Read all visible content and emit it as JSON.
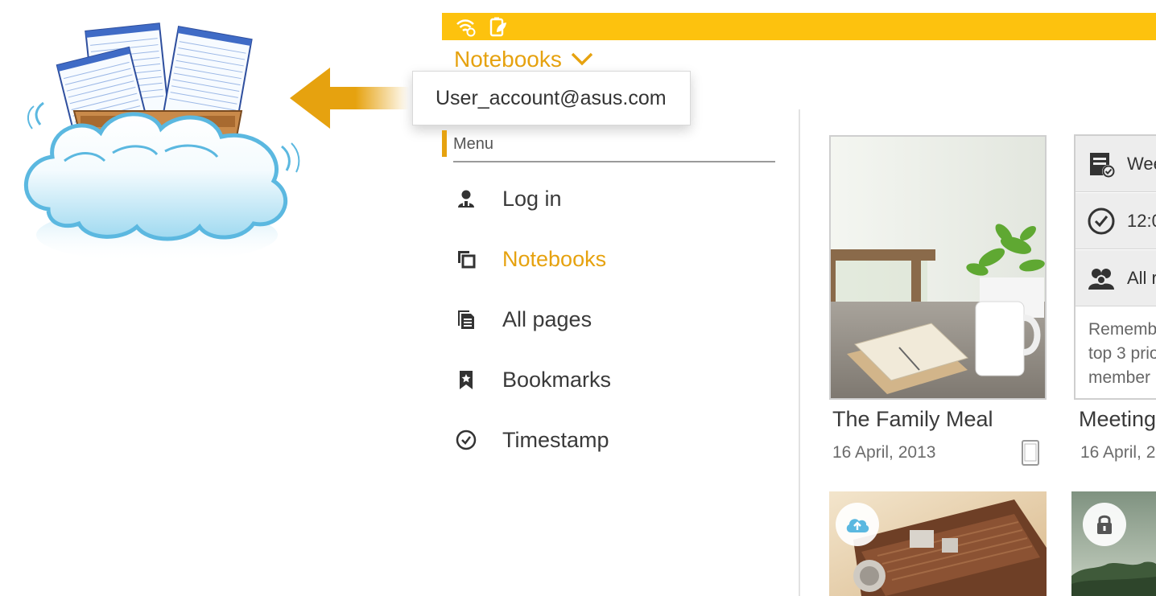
{
  "header": {
    "title": "Notebooks"
  },
  "account": {
    "email": "User_account@asus.com"
  },
  "menu": {
    "heading": "Menu",
    "items": [
      {
        "label": "Log in",
        "icon": "person-icon",
        "active": false
      },
      {
        "label": "Notebooks",
        "icon": "notebooks-icon",
        "active": true
      },
      {
        "label": "All pages",
        "icon": "pages-icon",
        "active": false
      },
      {
        "label": "Bookmarks",
        "icon": "bookmark-icon",
        "active": false
      },
      {
        "label": "Timestamp",
        "icon": "clock-check-icon",
        "active": false
      }
    ]
  },
  "cards": [
    {
      "title": "The Family Meal",
      "date": "16 April, 2013"
    },
    {
      "title": "Meeting",
      "date": "16 April, 2",
      "rows": [
        "Wee",
        "12:0",
        "All r"
      ],
      "note": [
        "Rememb",
        "top 3 prio",
        "member"
      ]
    }
  ],
  "colors": {
    "accent": "#e6a20f",
    "status_bar": "#fdc20e",
    "cloud": "#5bb8e0"
  }
}
